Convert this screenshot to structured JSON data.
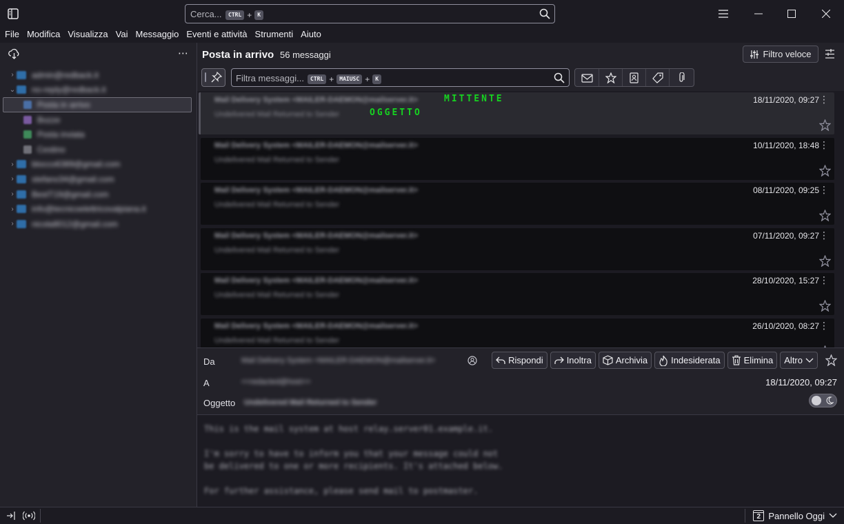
{
  "search": {
    "placeholder": "Cerca...",
    "key1": "CTRL",
    "plus": "+",
    "key2": "K"
  },
  "menu": [
    "File",
    "Modifica",
    "Visualizza",
    "Vai",
    "Messaggio",
    "Eventi e attività",
    "Strumenti",
    "Aiuto"
  ],
  "folders": [
    {
      "label": "admin@redback.it",
      "twisty": "›",
      "indent": 0
    },
    {
      "label": "no-reply@redback.it",
      "twisty": "⌄",
      "indent": 0
    },
    {
      "label": "Posta in arrivo",
      "twisty": "",
      "indent": 1
    },
    {
      "label": "Bozze",
      "twisty": "",
      "indent": 1
    },
    {
      "label": "Posta inviata",
      "twisty": "",
      "indent": 1
    },
    {
      "label": "Cestino",
      "twisty": "",
      "indent": 1
    },
    {
      "label": "blocco6389@gmail.com",
      "twisty": "›",
      "indent": 0
    },
    {
      "label": "stefano34@gmail.com",
      "twisty": "›",
      "indent": 0
    },
    {
      "label": "BestT19@gmail.com",
      "twisty": "›",
      "indent": 0
    },
    {
      "label": "info@tecnicoelettricovalpiana.it",
      "twisty": "›",
      "indent": 0
    },
    {
      "label": "nicola8012@gmail.com",
      "twisty": "›",
      "indent": 0
    }
  ],
  "thread": {
    "title": "Posta in arrivo",
    "count": "56 messaggi",
    "quick_filter": "Filtro veloce",
    "filter_placeholder": "Filtra messaggi...",
    "filter_key1": "CTRL",
    "filter_key2": "MAIUSC",
    "filter_key3": "K"
  },
  "messages": [
    {
      "from": "Mail Delivery System <MAILER-DAEMON@mailserver.it>",
      "subject": "Undelivered Mail Returned to Sender",
      "date": "18/11/2020, 09:27"
    },
    {
      "from": "Mail Delivery System <MAILER-DAEMON@mailserver.it>",
      "subject": "Undelivered Mail Returned to Sender",
      "date": "10/11/2020, 18:48"
    },
    {
      "from": "Mail Delivery System <MAILER-DAEMON@mailserver.it>",
      "subject": "Undelivered Mail Returned to Sender",
      "date": "08/11/2020, 09:25"
    },
    {
      "from": "Mail Delivery System <MAILER-DAEMON@mailserver.it>",
      "subject": "Undelivered Mail Returned to Sender",
      "date": "07/11/2020, 09:27"
    },
    {
      "from": "Mail Delivery System <MAILER-DAEMON@mailserver.it>",
      "subject": "Undelivered Mail Returned to Sender",
      "date": "28/10/2020, 15:27"
    },
    {
      "from": "Mail Delivery System <MAILER-DAEMON@mailserver.it>",
      "subject": "Undelivered Mail Returned to Sender",
      "date": "26/10/2020, 08:27"
    }
  ],
  "annotations": {
    "sender": "MITTENTE",
    "subject": "OGGETTO",
    "color": "#16d320"
  },
  "header": {
    "from_label": "Da",
    "from_value": "Mail Delivery System <MAILER-DAEMON@mailserver.it>",
    "to_label": "A",
    "to_value": "<<redacted@host>>",
    "subject_label": "Oggetto",
    "subject_value": "Undelivered Mail Returned to Sender",
    "date": "18/11/2020, 09:27",
    "buttons": {
      "reply": "Rispondi",
      "forward": "Inoltra",
      "archive": "Archivia",
      "junk": "Indesiderata",
      "delete": "Elimina",
      "more": "Altro"
    }
  },
  "body": [
    "This is the mail system at host relay.server01.example.it.",
    "I'm sorry to have to inform you that your message could not",
    "be delivered to one or more recipients. It's attached below.",
    "For further assistance, please send mail to postmaster."
  ],
  "status": {
    "today_pane": "Pannello Oggi",
    "calendar_day": "2"
  },
  "colors": {
    "background": "#1c1b22",
    "pane": "#232229",
    "card": "#0f0f12",
    "card_selected": "#2a2a30"
  }
}
